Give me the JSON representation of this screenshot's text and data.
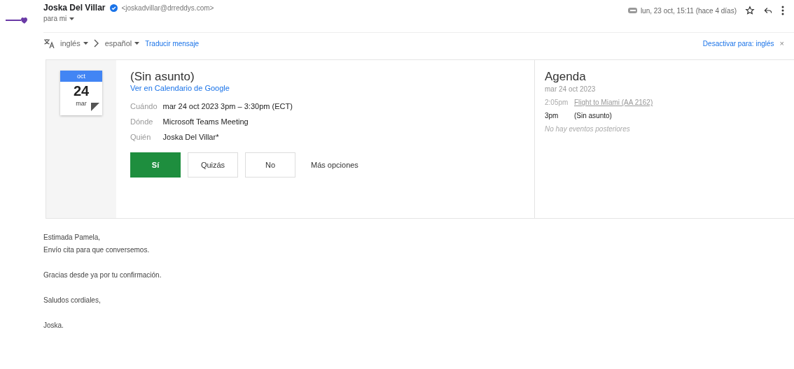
{
  "header": {
    "sender": "Joska Del Villar",
    "email": "<joskadvillar@drreddys.com>",
    "recipient": "para mi",
    "date": "lun, 23 oct, 15:11 (hace 4 días)"
  },
  "translate": {
    "from": "inglés",
    "to": "español",
    "action": "Traducir mensaje",
    "disable": "Desactivar para: inglés",
    "close": "×"
  },
  "invite": {
    "month": "oct",
    "day": "24",
    "weekday": "mar",
    "title": "(Sin asunto)",
    "calendar_link": "Ver en Calendario de Google",
    "details": [
      {
        "label": "Cuándo",
        "value": "mar 24 oct 2023 3pm – 3:30pm (ECT)"
      },
      {
        "label": "Dónde",
        "value": "Microsoft Teams Meeting"
      },
      {
        "label": "Quién",
        "value": "Joska Del Villar*"
      }
    ],
    "rsvp": [
      {
        "label": "Sí",
        "selected": true
      },
      {
        "label": "Quizás",
        "selected": false
      },
      {
        "label": "No",
        "selected": false
      }
    ],
    "more": "Más opciones"
  },
  "agenda": {
    "title": "Agenda",
    "date": "mar 24 oct 2023",
    "events": [
      {
        "time": "2:05pm",
        "title": "Flight to Miami (AA 2162)",
        "kind": "link"
      },
      {
        "time": "3pm",
        "title": "(Sin asunto)",
        "kind": "current"
      }
    ],
    "note": "No hay eventos posteriores"
  },
  "body": [
    {
      "lines": [
        "Estimada Pamela,",
        "Envío cita para que conversemos."
      ]
    },
    {
      "lines": [
        "Gracias desde ya por tu confirmación."
      ]
    },
    {
      "lines": [
        "Saludos cordiales,"
      ]
    },
    {
      "lines": [
        "Joska."
      ]
    }
  ]
}
